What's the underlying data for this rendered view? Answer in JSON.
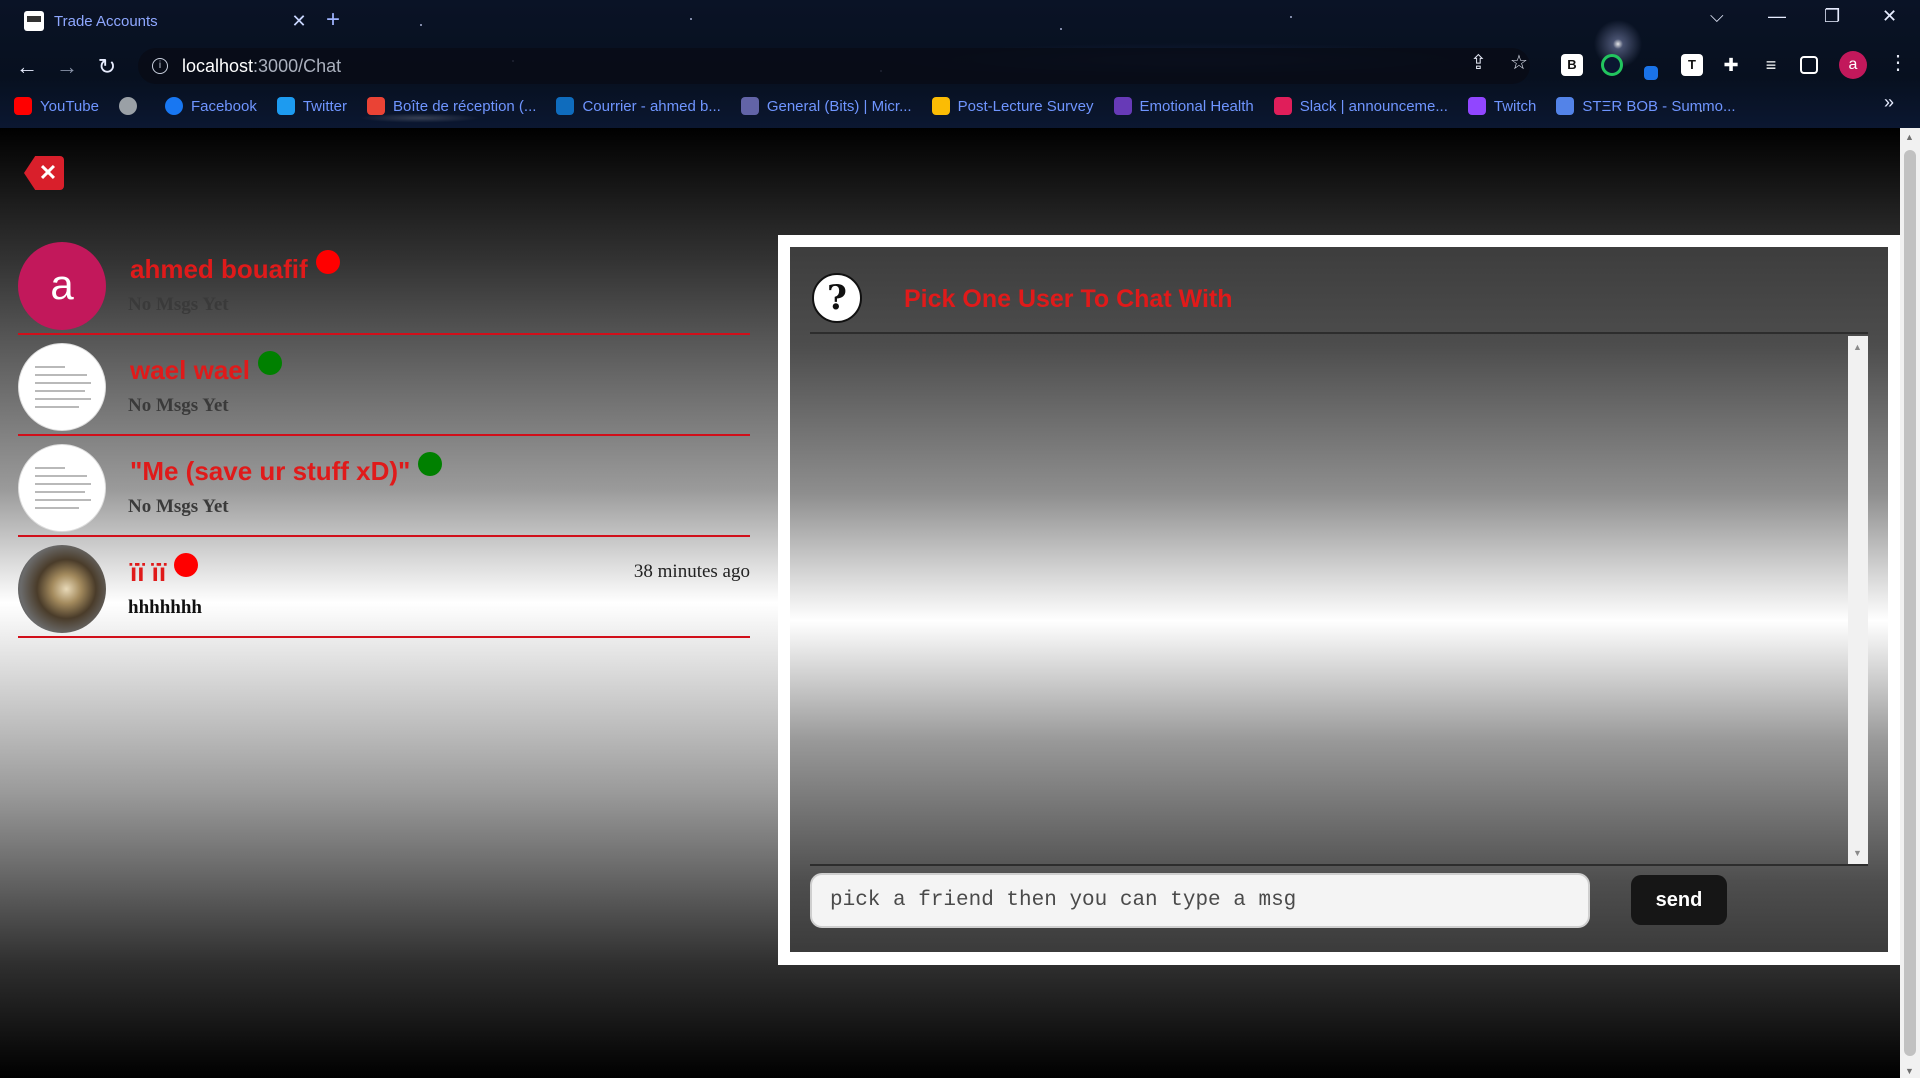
{
  "browser": {
    "tab_title": "Trade Accounts",
    "tab_close": "✕",
    "new_tab": "+",
    "url_host": "localhost",
    "url_path": ":3000/Chat",
    "profile_initial": "a",
    "window_controls": {
      "chevron": "⌵",
      "minimize": "—",
      "restore": "❐",
      "close": "✕"
    }
  },
  "bookmarks": [
    {
      "label": "YouTube",
      "icon": "youtube-icon",
      "color": "#ff0000"
    },
    {
      "label": "",
      "icon": "globe-icon",
      "color": "#9aa0a6"
    },
    {
      "label": "Facebook",
      "icon": "facebook-icon",
      "color": "#1877f2"
    },
    {
      "label": "Twitter",
      "icon": "twitter-icon",
      "color": "#1d9bf0"
    },
    {
      "label": "Boîte de réception (...",
      "icon": "gmail-icon",
      "color": "#ea4335"
    },
    {
      "label": "Courrier - ahmed b...",
      "icon": "outlook-icon",
      "color": "#0f6cbd"
    },
    {
      "label": "General (Bits) | Micr...",
      "icon": "teams-icon",
      "color": "#6264a7"
    },
    {
      "label": "Post-Lecture Survey",
      "icon": "drive-icon",
      "color": "#fbbc04"
    },
    {
      "label": "Emotional Health",
      "icon": "forms-icon",
      "color": "#673ab7"
    },
    {
      "label": "Slack | announceme...",
      "icon": "slack-icon",
      "color": "#e01e5a"
    },
    {
      "label": "Twitch",
      "icon": "twitch-icon",
      "color": "#9146ff"
    },
    {
      "label": "STΞR BOB - Summo...",
      "icon": "opgg-icon",
      "color": "#5383e8"
    }
  ],
  "bookmarks_more": "»",
  "page": {
    "close_icon": "✕",
    "contacts": [
      {
        "name": "ahmed bouafif",
        "status": "offline",
        "status_color": "#ff0000",
        "preview": "No Msgs Yet",
        "time": "",
        "avatar_type": "letter",
        "avatar_letter": "a"
      },
      {
        "name": "wael wael",
        "status": "online",
        "status_color": "#008000",
        "preview": "No Msgs Yet",
        "time": "",
        "avatar_type": "doc"
      },
      {
        "name": "\"Me (save ur stuff xD)\"",
        "status": "online",
        "status_color": "#008000",
        "preview": "No Msgs Yet",
        "time": "",
        "avatar_type": "doc"
      },
      {
        "name": "ïï ïï",
        "status": "offline",
        "status_color": "#ff0000",
        "preview": "hhhhhhh",
        "time": "38 minutes ago",
        "avatar_type": "photo"
      }
    ],
    "chat": {
      "icon_glyph": "?",
      "title": "Pick One User To Chat With",
      "input_placeholder": "pick a friend then you can type a msg",
      "send_label": "send"
    }
  }
}
